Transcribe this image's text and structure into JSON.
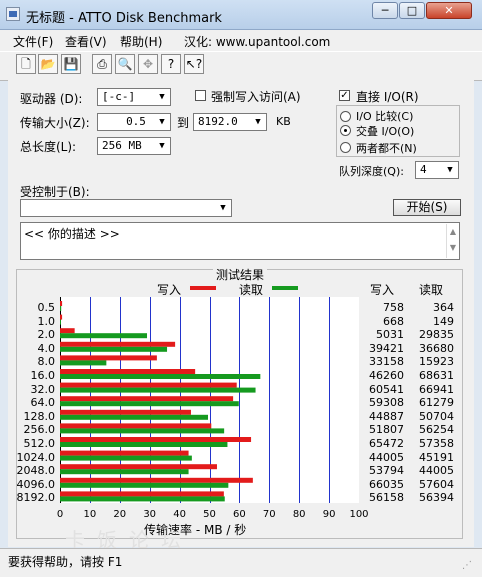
{
  "window": {
    "title": "无标题 - ATTO Disk Benchmark",
    "min": "─",
    "max": "□",
    "close": "✕"
  },
  "menu": [
    "文件(F)",
    "查看(V)",
    "帮助(H)",
    "汉化: www.upantool.com"
  ],
  "toolbar": [
    "new-icon",
    "open-icon",
    "save-icon",
    "print-icon",
    "print-preview-icon",
    "move-icon",
    "help-icon",
    "context-help-icon"
  ],
  "settings": {
    "drive_label": "驱动器 (D):",
    "drive_value": "[-c-]",
    "force_write_label": "强制写入访问(A)",
    "transfer_label": "传输大小(Z):",
    "transfer_from": "0.5",
    "to_label": "到",
    "transfer_to": "8192.0",
    "kb_label": "KB",
    "total_label": "总长度(L):",
    "total_value": "256 MB",
    "direct_io_label": "直接 I/O(R)",
    "io_compare_label": "I/O 比较(C)",
    "overlapped_io_label": "交叠 I/O(O)",
    "neither_label": "两者都不(N)",
    "queue_label": "队列深度(Q):",
    "queue_value": "4",
    "controlled_label": "受控制于(B):",
    "controlled_value": "",
    "start_label": "开始(S)",
    "description": "<<  你的描述  >>"
  },
  "results": {
    "title": "测试结果",
    "write_legend": "写入",
    "read_legend": "读取",
    "write_header": "写入",
    "read_header": "读取",
    "xlabel": "传输速率 - MB / 秒",
    "watermark": "卡饭论坛",
    "colors": {
      "write": "#e31b1b",
      "read": "#159a1f",
      "grid": "#2233cc"
    }
  },
  "chart_data": {
    "type": "bar",
    "title": "测试结果",
    "xlabel": "传输速率 - MB / 秒",
    "xlim": [
      0,
      100
    ],
    "ticks": [
      0,
      10,
      20,
      30,
      40,
      50,
      60,
      70,
      80,
      90,
      100
    ],
    "categories": [
      "0.5",
      "1.0",
      "2.0",
      "4.0",
      "8.0",
      "16.0",
      "32.0",
      "64.0",
      "128.0",
      "256.0",
      "512.0",
      "1024.0",
      "2048.0",
      "4096.0",
      "8192.0"
    ],
    "series": [
      {
        "name": "写入",
        "display": [
          "758",
          "668",
          "5031",
          "39421",
          "33158",
          "46260",
          "60541",
          "59308",
          "44887",
          "51807",
          "65472",
          "44005",
          "53794",
          "66035",
          "56158"
        ],
        "values": [
          0.7,
          0.7,
          4.9,
          38.5,
          32.4,
          45.2,
          59.1,
          57.9,
          43.8,
          50.6,
          63.9,
          43.0,
          52.5,
          64.5,
          54.8
        ]
      },
      {
        "name": "读取",
        "display": [
          "364",
          "149",
          "29835",
          "36680",
          "15923",
          "68631",
          "66941",
          "61279",
          "50704",
          "56254",
          "57358",
          "45191",
          "44005",
          "57604",
          "56394"
        ],
        "values": [
          0.4,
          0.1,
          29.1,
          35.8,
          15.5,
          67.0,
          65.4,
          59.8,
          49.5,
          54.9,
          56.0,
          44.1,
          43.0,
          56.3,
          55.1
        ]
      }
    ]
  },
  "status": "要获得帮助，请按 F1"
}
